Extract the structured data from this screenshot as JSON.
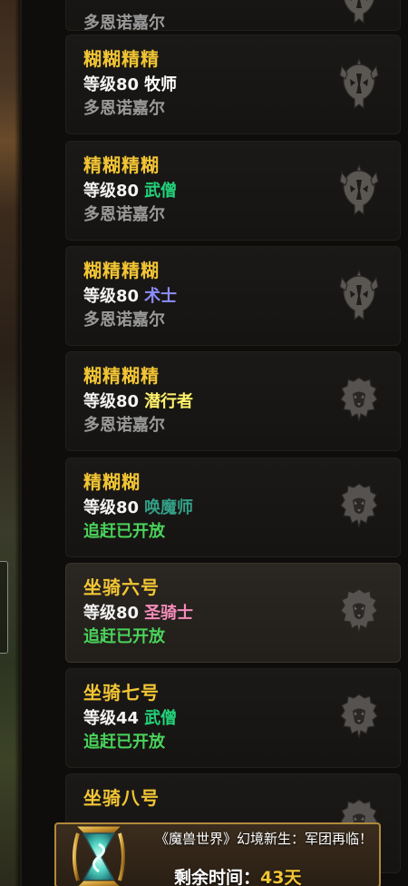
{
  "characters": [
    {
      "name": "",
      "level": "",
      "class": "",
      "class_color": "#f4f4f4",
      "realm": "多恩诺嘉尔",
      "realm_type": "realm",
      "faction": "horde-icon"
    },
    {
      "name": "糊糊精精",
      "level": "等级80",
      "class": "牧师",
      "class_color": "#ffffff",
      "realm": "多恩诺嘉尔",
      "realm_type": "realm",
      "faction": "horde-icon"
    },
    {
      "name": "精糊精糊",
      "level": "等级80",
      "class": "武僧",
      "class_color": "#22d37a",
      "realm": "多恩诺嘉尔",
      "realm_type": "realm",
      "faction": "horde-icon"
    },
    {
      "name": "糊精精糊",
      "level": "等级80",
      "class": "术士",
      "class_color": "#8d8dff",
      "realm": "多恩诺嘉尔",
      "realm_type": "realm",
      "faction": "horde-icon"
    },
    {
      "name": "糊精糊精",
      "level": "等级80",
      "class": "潜行者",
      "class_color": "#fff36a",
      "realm": "多恩诺嘉尔",
      "realm_type": "realm",
      "faction": "alliance-lion-icon"
    },
    {
      "name": "精糊糊",
      "level": "等级80",
      "class": "唤魔师",
      "class_color": "#33a087",
      "realm": "追赶已开放",
      "realm_type": "open",
      "faction": "alliance-lion-icon"
    },
    {
      "name": "坐骑六号",
      "level": "等级80",
      "class": "圣骑士",
      "class_color": "#f48cba",
      "realm": "追赶已开放",
      "realm_type": "open",
      "faction": "alliance-lion-icon",
      "selected": true
    },
    {
      "name": "坐骑七号",
      "level": "等级44",
      "class": "武僧",
      "class_color": "#22d37a",
      "realm": "追赶已开放",
      "realm_type": "open",
      "faction": "alliance-lion-icon"
    },
    {
      "name": "坐骑八号",
      "level": "",
      "class": "",
      "class_color": "#f4f4f4",
      "realm": "",
      "realm_type": "realm",
      "faction": "alliance-lion-icon"
    }
  ],
  "banner": {
    "title": "《魔兽世界》幻境新生：军团再临！",
    "remaining_label": "剩余时间：",
    "remaining_days": "43天"
  },
  "colors": {
    "name": "#f2c534",
    "realm": "#9a9a9a",
    "open": "#49d35a",
    "banner_border": "#b08a3c"
  }
}
